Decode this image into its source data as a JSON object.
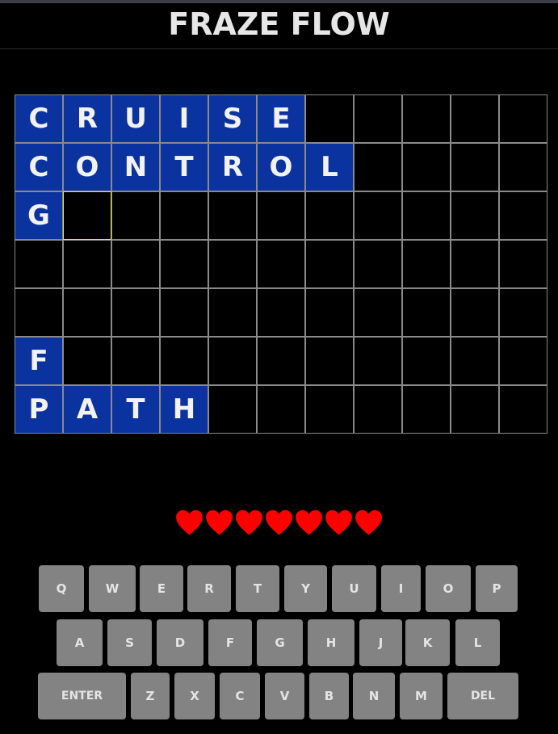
{
  "title": "FRAZE FLOW",
  "colors": {
    "background": "#000000",
    "filled_cell": "#0b33a0",
    "grid_line": "#8a8a8a",
    "active_cell_border": "#e8e337",
    "heart": "#ff0000",
    "key": "#838383"
  },
  "board": {
    "rows": [
      [
        "C",
        "R",
        "U",
        "I",
        "S",
        "E",
        "",
        "",
        "",
        "",
        ""
      ],
      [
        "C",
        "O",
        "N",
        "T",
        "R",
        "O",
        "L",
        "",
        "",
        "",
        ""
      ],
      [
        "G",
        "",
        "",
        "",
        "",
        "",
        "",
        "",
        "",
        "",
        ""
      ],
      [
        "",
        "",
        "",
        "",
        "",
        "",
        "",
        "",
        "",
        "",
        ""
      ],
      [
        "",
        "",
        "",
        "",
        "",
        "",
        "",
        "",
        "",
        "",
        ""
      ],
      [
        "F",
        "",
        "",
        "",
        "",
        "",
        "",
        "",
        "",
        "",
        ""
      ],
      [
        "P",
        "A",
        "T",
        "H",
        "",
        "",
        "",
        "",
        "",
        "",
        ""
      ]
    ],
    "filled": [
      [
        true,
        true,
        true,
        true,
        true,
        true,
        false,
        false,
        false,
        false,
        false
      ],
      [
        true,
        true,
        true,
        true,
        true,
        true,
        true,
        false,
        false,
        false,
        false
      ],
      [
        true,
        false,
        false,
        false,
        false,
        false,
        false,
        false,
        false,
        false,
        false
      ],
      [
        false,
        false,
        false,
        false,
        false,
        false,
        false,
        false,
        false,
        false,
        false
      ],
      [
        false,
        false,
        false,
        false,
        false,
        false,
        false,
        false,
        false,
        false,
        false
      ],
      [
        true,
        false,
        false,
        false,
        false,
        false,
        false,
        false,
        false,
        false,
        false
      ],
      [
        true,
        true,
        true,
        true,
        false,
        false,
        false,
        false,
        false,
        false,
        false
      ]
    ],
    "active_cell": [
      2,
      1
    ]
  },
  "lives": {
    "remaining": 7,
    "icon": "heart-icon"
  },
  "keyboard": {
    "rows": [
      [
        "Q",
        "W",
        "E",
        "R",
        "T",
        "Y",
        "U",
        "I",
        "O",
        "P"
      ],
      [
        "A",
        "S",
        "D",
        "F",
        "G",
        "H",
        "J",
        "K",
        "L"
      ],
      [
        "ENTER",
        "Z",
        "X",
        "C",
        "V",
        "B",
        "N",
        "M",
        "DEL"
      ]
    ]
  }
}
